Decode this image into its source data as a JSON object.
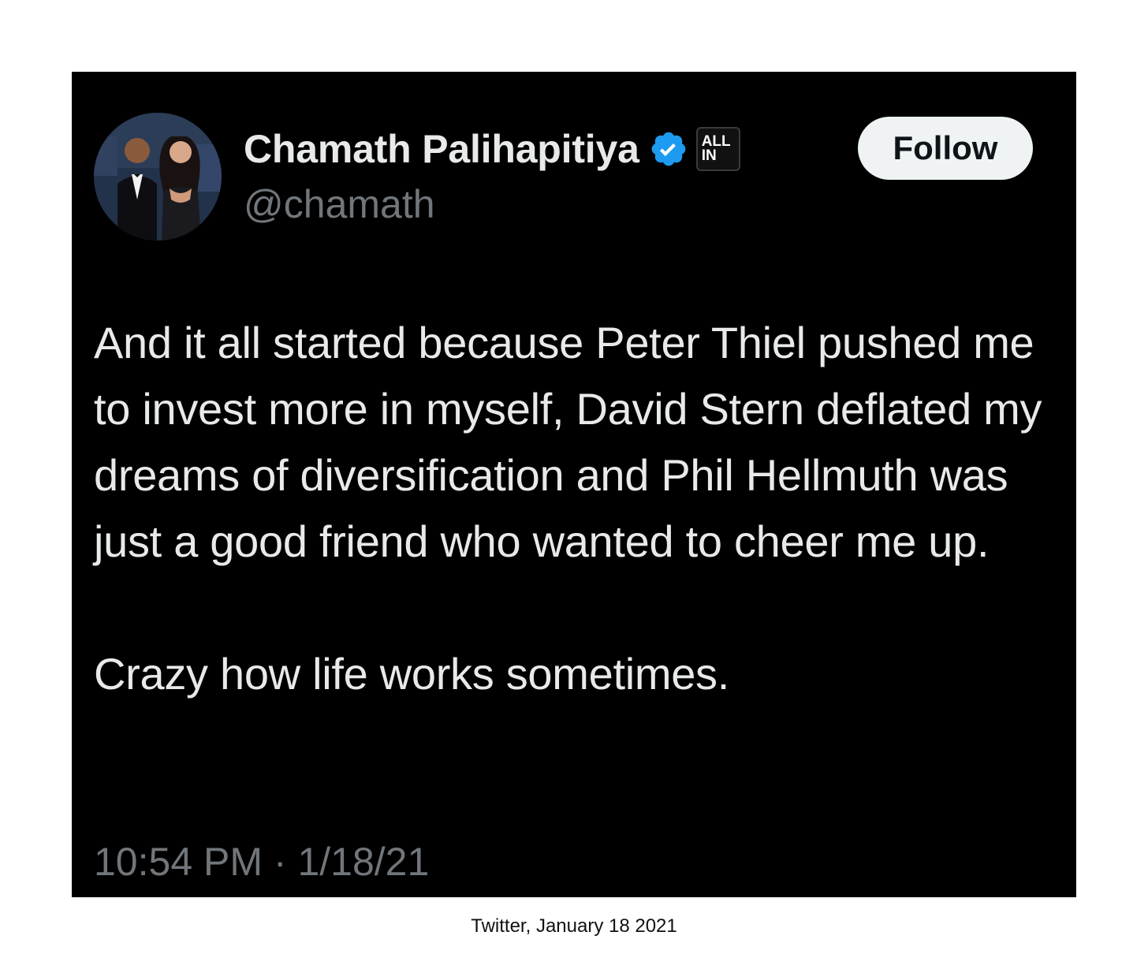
{
  "tweet": {
    "author": {
      "display_name": "Chamath Palihapitiya",
      "handle": "@chamath",
      "verified_icon": "verified-checkmark-icon",
      "verified_color": "#1d9bf0",
      "affiliate_badge_lines": [
        "ALL",
        "IN"
      ]
    },
    "follow_label": "Follow",
    "body": {
      "paragraph_1": "And it all started because Peter Thiel pushed me to invest more in myself, David Stern deflated my dreams of diversification and Phil Hellmuth was just a good friend who wanted to cheer me up.",
      "paragraph_2": "Crazy how life works sometimes."
    },
    "timestamp": "10:54 PM · 1/18/21"
  },
  "caption": "Twitter, January 18 2021",
  "colors": {
    "card_background": "#000000",
    "primary_text": "#e7e9ea",
    "secondary_text": "#71767b",
    "follow_button_bg": "#eff3f4",
    "follow_button_text": "#0f1419",
    "page_background": "#ffffff"
  }
}
